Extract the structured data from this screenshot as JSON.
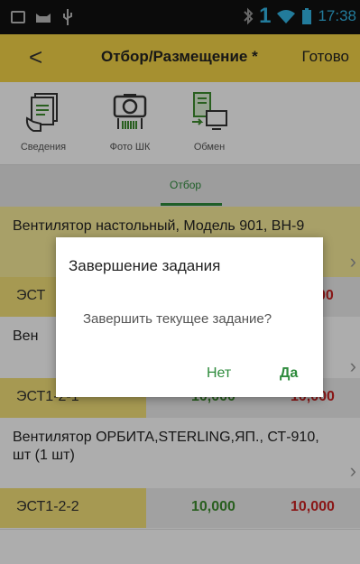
{
  "status_bar": {
    "time": "17:38",
    "signal_text": "1",
    "icons": [
      "gallery-icon",
      "cat-icon",
      "usb-icon",
      "bluetooth-icon",
      "wifi-icon",
      "battery-icon"
    ]
  },
  "header": {
    "back_label": "<",
    "title": "Отбор/Размещение *",
    "done_label": "Готово"
  },
  "toolbar": {
    "items": [
      {
        "label": "Сведения",
        "icon": "document-icon"
      },
      {
        "label": "Фото ШК",
        "icon": "camera-barcode-icon"
      },
      {
        "label": "Обмен",
        "icon": "exchange-icon"
      }
    ]
  },
  "tabs": [
    {
      "label": "Отбор",
      "active": true
    }
  ],
  "list": {
    "items": [
      {
        "name": "Вентилятор настольный, Модель 901, ВН-9",
        "location": "ЭСТ",
        "qty_plan": "",
        "qty_fact": "00"
      },
      {
        "name": "Вен",
        "location": "ЭСТ1-2-1",
        "qty_plan": "10,000",
        "qty_fact": "10,000"
      },
      {
        "name": "Вентилятор ОРБИТА,STERLING,ЯП., СТ-910, шт (1 шт)",
        "location": "ЭСТ1-2-2",
        "qty_plan": "10,000",
        "qty_fact": "10,000"
      }
    ]
  },
  "dialog": {
    "title": "Завершение задания",
    "message": "Завершить текущее задание?",
    "no_label": "Нет",
    "yes_label": "Да"
  },
  "colors": {
    "header_bg": "#f5d547",
    "accent_green": "#2e8b3c",
    "qty_green": "#3d8d2e",
    "qty_red": "#cc2222",
    "location_bg": "#f5e27a"
  }
}
